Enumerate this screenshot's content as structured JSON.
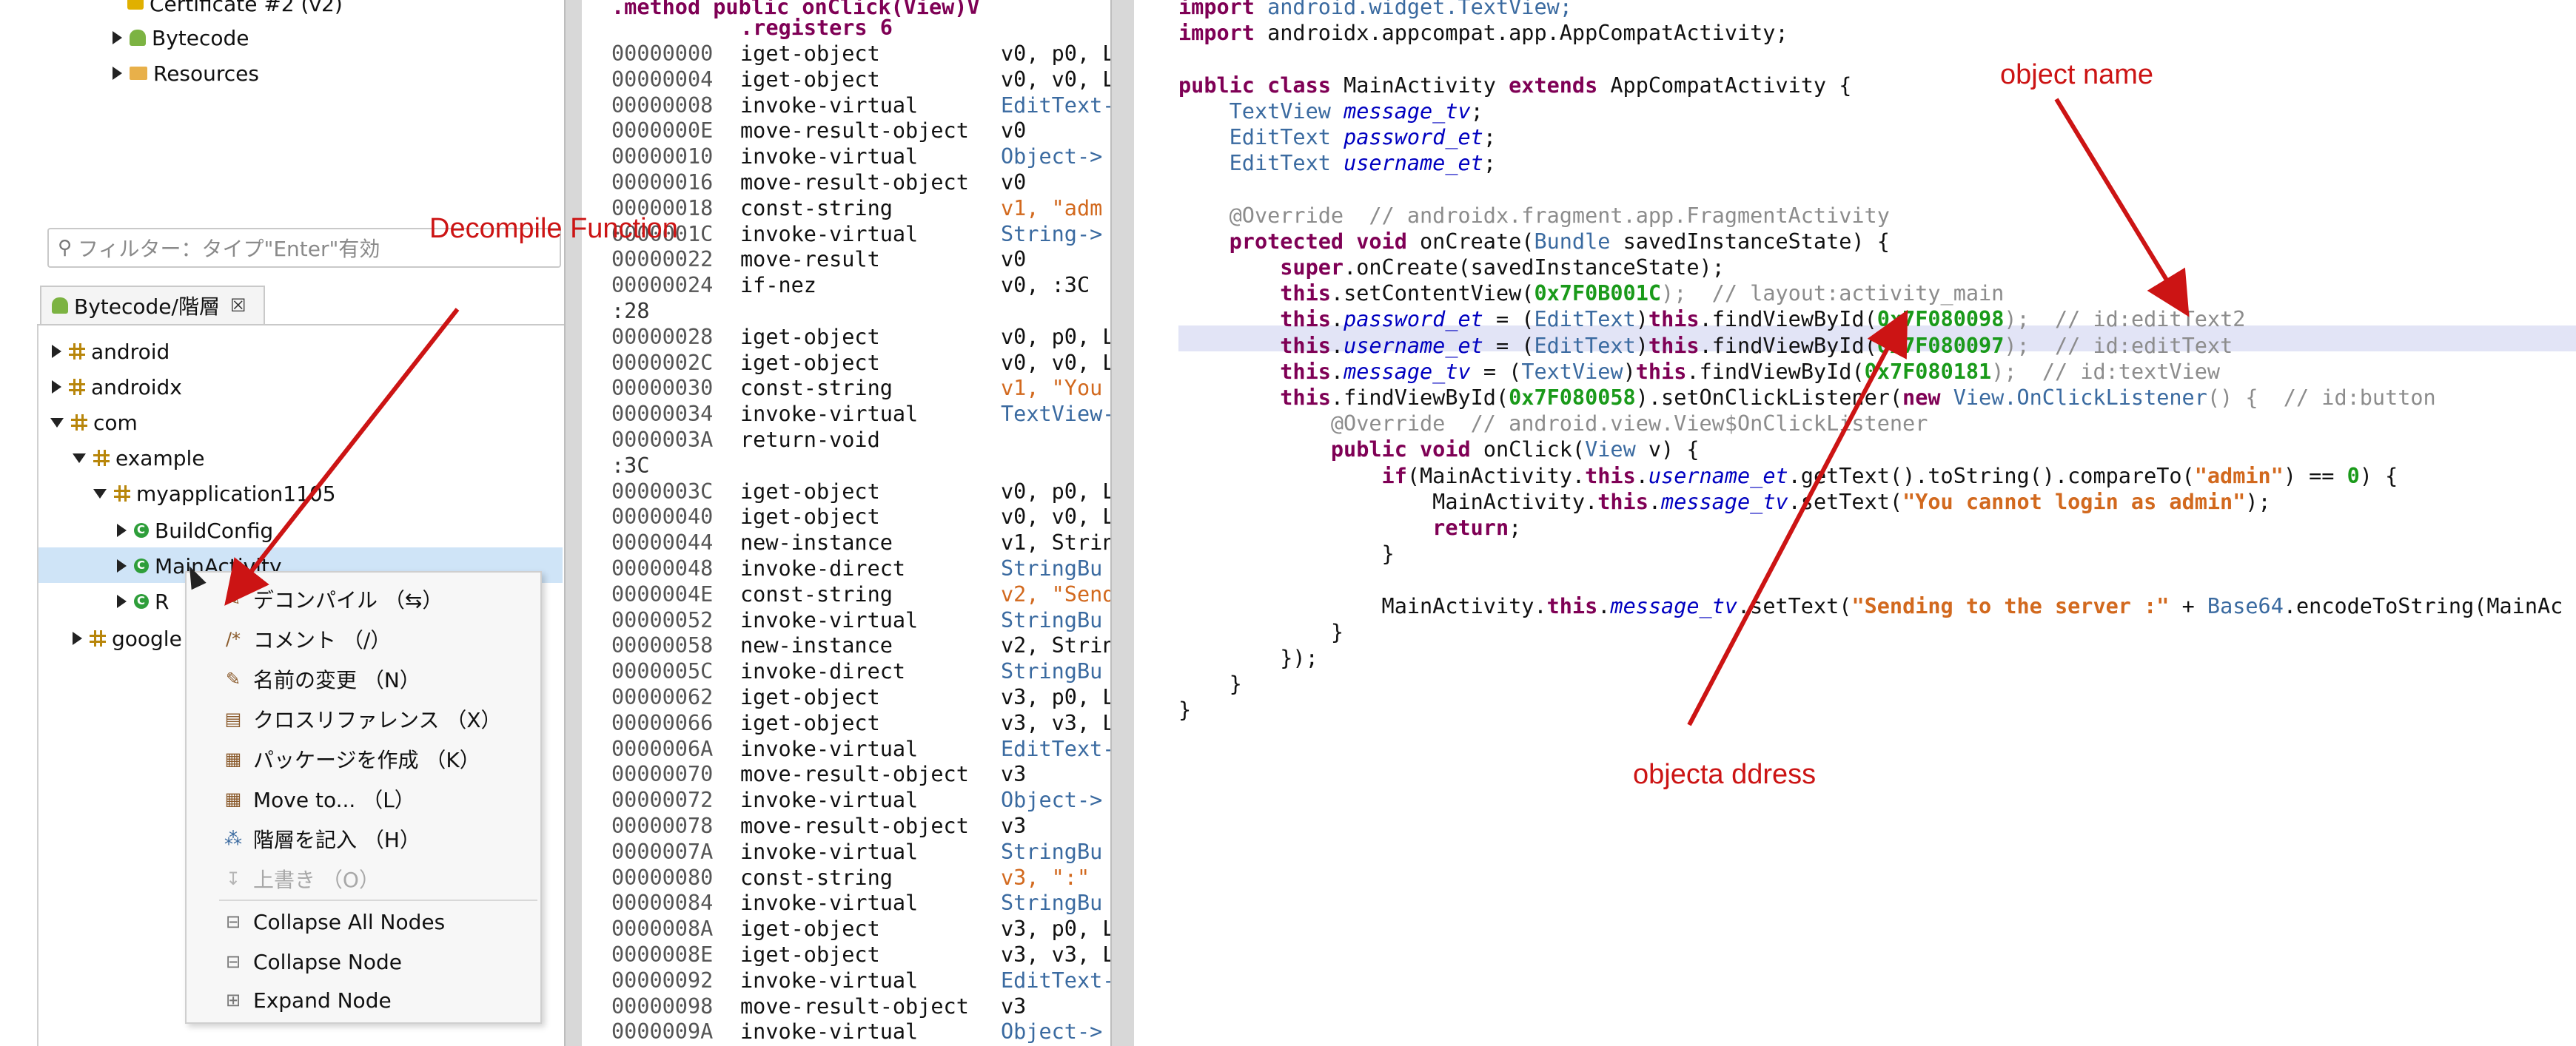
{
  "tree_top": {
    "items": [
      {
        "label": "Certificate #2 (v2)"
      },
      {
        "label": "Bytecode"
      },
      {
        "label": "Resources"
      }
    ]
  },
  "filter": {
    "placeholder": "フィルター：タイプ\"Enter\"有効"
  },
  "hierarchy_tab": {
    "label": "Bytecode/階層",
    "close": "☒"
  },
  "tree": {
    "android": "android",
    "androidx": "androidx",
    "com": "com",
    "example": "example",
    "myapplication": "myapplication1105",
    "buildconfig": "BuildConfig",
    "mainactivity": "MainActivity",
    "r": "R",
    "google": "google"
  },
  "context_menu": {
    "items": [
      {
        "label": "デコンパイル （⇆）",
        "icon": "decompile-icon",
        "glyph": "✎"
      },
      {
        "label": "コメント （/）",
        "icon": "comment-icon",
        "glyph": "/*"
      },
      {
        "label": "名前の変更 （N）",
        "icon": "rename-icon",
        "glyph": "✎"
      },
      {
        "label": "クロスリファレンス （X）",
        "icon": "xref-icon",
        "glyph": "▤"
      },
      {
        "label": "パッケージを作成 （K）",
        "icon": "package-icon",
        "glyph": "▦"
      },
      {
        "label": "Move to... （L）",
        "icon": "move-icon",
        "glyph": "▦"
      },
      {
        "label": "階層を記入 （H）",
        "icon": "hierarchy-icon",
        "glyph": "⁂"
      },
      {
        "label": "上書き （O）",
        "icon": "override-icon",
        "glyph": "↧"
      },
      {
        "label": "Collapse All Nodes",
        "icon": "collapse-all-icon",
        "glyph": "⊟"
      },
      {
        "label": "Collapse Node",
        "icon": "collapse-node-icon",
        "glyph": "⊟"
      },
      {
        "label": "Expand Node",
        "icon": "expand-node-icon",
        "glyph": "⊞"
      }
    ]
  },
  "bytecode": {
    "header1": ".method public onClick(View)V",
    "header2": ".registers 6",
    "rows": [
      {
        "addr": "00000000",
        "op": "iget-object",
        "args": "v0, p0, L"
      },
      {
        "addr": "00000004",
        "op": "iget-object",
        "args": "v0, v0, L"
      },
      {
        "addr": "00000008",
        "op": "invoke-virtual",
        "args": "EditText-"
      },
      {
        "addr": "0000000E",
        "op": "move-result-object",
        "args": "v0"
      },
      {
        "addr": "00000010",
        "op": "invoke-virtual",
        "args": "Object->"
      },
      {
        "addr": "00000016",
        "op": "move-result-object",
        "args": "v0"
      },
      {
        "addr": "00000018",
        "op": "const-string",
        "args": "v1, \"adm"
      },
      {
        "addr": "0000001C",
        "op": "invoke-virtual",
        "args": "String->"
      },
      {
        "addr": "00000022",
        "op": "move-result",
        "args": "v0"
      },
      {
        "addr": "00000024",
        "op": "if-nez",
        "args": "v0, :3C"
      },
      {
        "label": ":28"
      },
      {
        "addr": "00000028",
        "op": "iget-object",
        "args": "v0, p0, L"
      },
      {
        "addr": "0000002C",
        "op": "iget-object",
        "args": "v0, v0, L"
      },
      {
        "addr": "00000030",
        "op": "const-string",
        "args": "v1, \"You"
      },
      {
        "addr": "00000034",
        "op": "invoke-virtual",
        "args": "TextView-"
      },
      {
        "addr": "0000003A",
        "op": "return-void",
        "args": ""
      },
      {
        "label": ":3C"
      },
      {
        "addr": "0000003C",
        "op": "iget-object",
        "args": "v0, p0, L"
      },
      {
        "addr": "00000040",
        "op": "iget-object",
        "args": "v0, v0, L"
      },
      {
        "addr": "00000044",
        "op": "new-instance",
        "args": "v1, Strin"
      },
      {
        "addr": "00000048",
        "op": "invoke-direct",
        "args": "StringBu"
      },
      {
        "addr": "0000004E",
        "op": "const-string",
        "args": "v2, \"Send"
      },
      {
        "addr": "00000052",
        "op": "invoke-virtual",
        "args": "StringBu"
      },
      {
        "addr": "00000058",
        "op": "new-instance",
        "args": "v2, Strin"
      },
      {
        "addr": "0000005C",
        "op": "invoke-direct",
        "args": "StringBu"
      },
      {
        "addr": "00000062",
        "op": "iget-object",
        "args": "v3, p0, L"
      },
      {
        "addr": "00000066",
        "op": "iget-object",
        "args": "v3, v3, L"
      },
      {
        "addr": "0000006A",
        "op": "invoke-virtual",
        "args": "EditText-"
      },
      {
        "addr": "00000070",
        "op": "move-result-object",
        "args": "v3"
      },
      {
        "addr": "00000072",
        "op": "invoke-virtual",
        "args": "Object->"
      },
      {
        "addr": "00000078",
        "op": "move-result-object",
        "args": "v3"
      },
      {
        "addr": "0000007A",
        "op": "invoke-virtual",
        "args": "StringBu"
      },
      {
        "addr": "00000080",
        "op": "const-string",
        "args": "v3, \":\""
      },
      {
        "addr": "00000084",
        "op": "invoke-virtual",
        "args": "StringBu"
      },
      {
        "addr": "0000008A",
        "op": "iget-object",
        "args": "v3, p0, L"
      },
      {
        "addr": "0000008E",
        "op": "iget-object",
        "args": "v3, v3, L"
      },
      {
        "addr": "00000092",
        "op": "invoke-virtual",
        "args": "EditText-"
      },
      {
        "addr": "00000098",
        "op": "move-result-object",
        "args": "v3"
      },
      {
        "addr": "0000009A",
        "op": "invoke-virtual",
        "args": "Object->"
      }
    ]
  },
  "java": {
    "lines": [
      [
        {
          "t": "import",
          "c": "kw"
        },
        {
          "t": " android.widget.TextView;",
          "c": "typ"
        }
      ],
      [
        {
          "t": "import",
          "c": "kw"
        },
        {
          "t": " androidx.appcompat.app.AppCompatActivity;",
          "c": ""
        }
      ],
      [],
      [
        {
          "t": "public class",
          "c": "kw"
        },
        {
          "t": " MainActivity ",
          "c": ""
        },
        {
          "t": "extends",
          "c": "kw"
        },
        {
          "t": " AppCompatActivity {",
          "c": ""
        }
      ],
      [
        {
          "t": "    TextView ",
          "c": "typ"
        },
        {
          "t": "message_tv",
          "c": "fld"
        },
        {
          "t": ";",
          "c": ""
        }
      ],
      [
        {
          "t": "    EditText ",
          "c": "typ"
        },
        {
          "t": "password_et",
          "c": "fld"
        },
        {
          "t": ";",
          "c": ""
        }
      ],
      [
        {
          "t": "    EditText ",
          "c": "typ"
        },
        {
          "t": "username_et",
          "c": "fld"
        },
        {
          "t": ";",
          "c": ""
        }
      ],
      [],
      [
        {
          "t": "    @Override  // androidx.fragment.app.FragmentActivity",
          "c": "cmt"
        }
      ],
      [
        {
          "t": "    protected void",
          "c": "kw"
        },
        {
          "t": " onCreate(",
          "c": ""
        },
        {
          "t": "Bundle",
          "c": "typ"
        },
        {
          "t": " savedInstanceState) {",
          "c": ""
        }
      ],
      [
        {
          "t": "        super",
          "c": "kw"
        },
        {
          "t": ".onCreate(savedInstanceState);",
          "c": ""
        }
      ],
      [
        {
          "t": "        this",
          "c": "kw"
        },
        {
          "t": ".setContentView(",
          "c": ""
        },
        {
          "t": "0x7F0B001C",
          "c": "num"
        },
        {
          "t": ");  // layout:activity_main",
          "c": "cmt"
        }
      ],
      [
        {
          "t": "        this",
          "c": "kw"
        },
        {
          "t": ".",
          "c": ""
        },
        {
          "t": "password_et",
          "c": "fld"
        },
        {
          "t": " = (",
          "c": ""
        },
        {
          "t": "EditText",
          "c": "typ"
        },
        {
          "t": ")",
          "c": ""
        },
        {
          "t": "this",
          "c": "kw"
        },
        {
          "t": ".findViewById(",
          "c": ""
        },
        {
          "t": "0x7F080098",
          "c": "num"
        },
        {
          "t": ");  // id:editText2",
          "c": "cmt"
        }
      ],
      [
        {
          "t": "        this",
          "c": "kw"
        },
        {
          "t": ".",
          "c": ""
        },
        {
          "t": "username_et",
          "c": "fld"
        },
        {
          "t": " = (",
          "c": ""
        },
        {
          "t": "EditText",
          "c": "typ"
        },
        {
          "t": ")",
          "c": ""
        },
        {
          "t": "this",
          "c": "kw"
        },
        {
          "t": ".findViewById(",
          "c": ""
        },
        {
          "t": "0x7F080097",
          "c": "num"
        },
        {
          "t": ");  // id:editText",
          "c": "cmt"
        }
      ],
      [
        {
          "t": "        this",
          "c": "kw"
        },
        {
          "t": ".",
          "c": ""
        },
        {
          "t": "message_tv",
          "c": "fld"
        },
        {
          "t": " = (",
          "c": ""
        },
        {
          "t": "TextView",
          "c": "typ"
        },
        {
          "t": ")",
          "c": ""
        },
        {
          "t": "this",
          "c": "kw"
        },
        {
          "t": ".findViewById(",
          "c": ""
        },
        {
          "t": "0x7F080181",
          "c": "num"
        },
        {
          "t": ");  // id:textView",
          "c": "cmt"
        }
      ],
      [
        {
          "t": "        this",
          "c": "kw"
        },
        {
          "t": ".findViewById(",
          "c": ""
        },
        {
          "t": "0x7F080058",
          "c": "num"
        },
        {
          "t": ").setOnClickListener(",
          "c": ""
        },
        {
          "t": "new",
          "c": "kw"
        },
        {
          "t": " View.OnClickListener",
          "c": "typ"
        },
        {
          "t": "() {  // id:button",
          "c": "cmt"
        }
      ],
      [
        {
          "t": "            @Override  // android.view.View$OnClickListener",
          "c": "cmt"
        }
      ],
      [
        {
          "t": "            public void",
          "c": "kw"
        },
        {
          "t": " onClick(",
          "c": ""
        },
        {
          "t": "View",
          "c": "typ"
        },
        {
          "t": " v) {",
          "c": ""
        }
      ],
      [
        {
          "t": "                if",
          "c": "kw"
        },
        {
          "t": "(MainActivity.",
          "c": ""
        },
        {
          "t": "this",
          "c": "kw"
        },
        {
          "t": ".",
          "c": ""
        },
        {
          "t": "username_et",
          "c": "fld"
        },
        {
          "t": ".getText().toString().compareTo(",
          "c": ""
        },
        {
          "t": "\"admin\"",
          "c": "str"
        },
        {
          "t": ") == ",
          "c": ""
        },
        {
          "t": "0",
          "c": "num"
        },
        {
          "t": ") {",
          "c": ""
        }
      ],
      [
        {
          "t": "                    MainActivity.",
          "c": ""
        },
        {
          "t": "this",
          "c": "kw"
        },
        {
          "t": ".",
          "c": ""
        },
        {
          "t": "message_tv",
          "c": "fld"
        },
        {
          "t": ".setText(",
          "c": ""
        },
        {
          "t": "\"You cannot login as admin\"",
          "c": "str"
        },
        {
          "t": ");",
          "c": ""
        }
      ],
      [
        {
          "t": "                    return",
          "c": "kw"
        },
        {
          "t": ";",
          "c": ""
        }
      ],
      [
        {
          "t": "                }",
          "c": ""
        }
      ],
      [],
      [
        {
          "t": "                MainActivity.",
          "c": ""
        },
        {
          "t": "this",
          "c": "kw"
        },
        {
          "t": ".",
          "c": ""
        },
        {
          "t": "message_tv",
          "c": "fld"
        },
        {
          "t": ".setText(",
          "c": ""
        },
        {
          "t": "\"Sending to the server :\"",
          "c": "str"
        },
        {
          "t": " + ",
          "c": ""
        },
        {
          "t": "Base64",
          "c": "typ"
        },
        {
          "t": ".encodeToString(MainAc",
          "c": ""
        }
      ],
      [
        {
          "t": "            }",
          "c": ""
        }
      ],
      [
        {
          "t": "        });",
          "c": ""
        }
      ],
      [
        {
          "t": "    }",
          "c": ""
        }
      ],
      [
        {
          "t": "}",
          "c": ""
        }
      ]
    ]
  },
  "annotations": {
    "decompile": "Decompile Function",
    "object_name": "object name",
    "object_address": "objecta ddress"
  },
  "colors": {
    "annotation_red": "#cc1414",
    "selection": "#cfe4f7",
    "keyword": "#7f0055"
  }
}
